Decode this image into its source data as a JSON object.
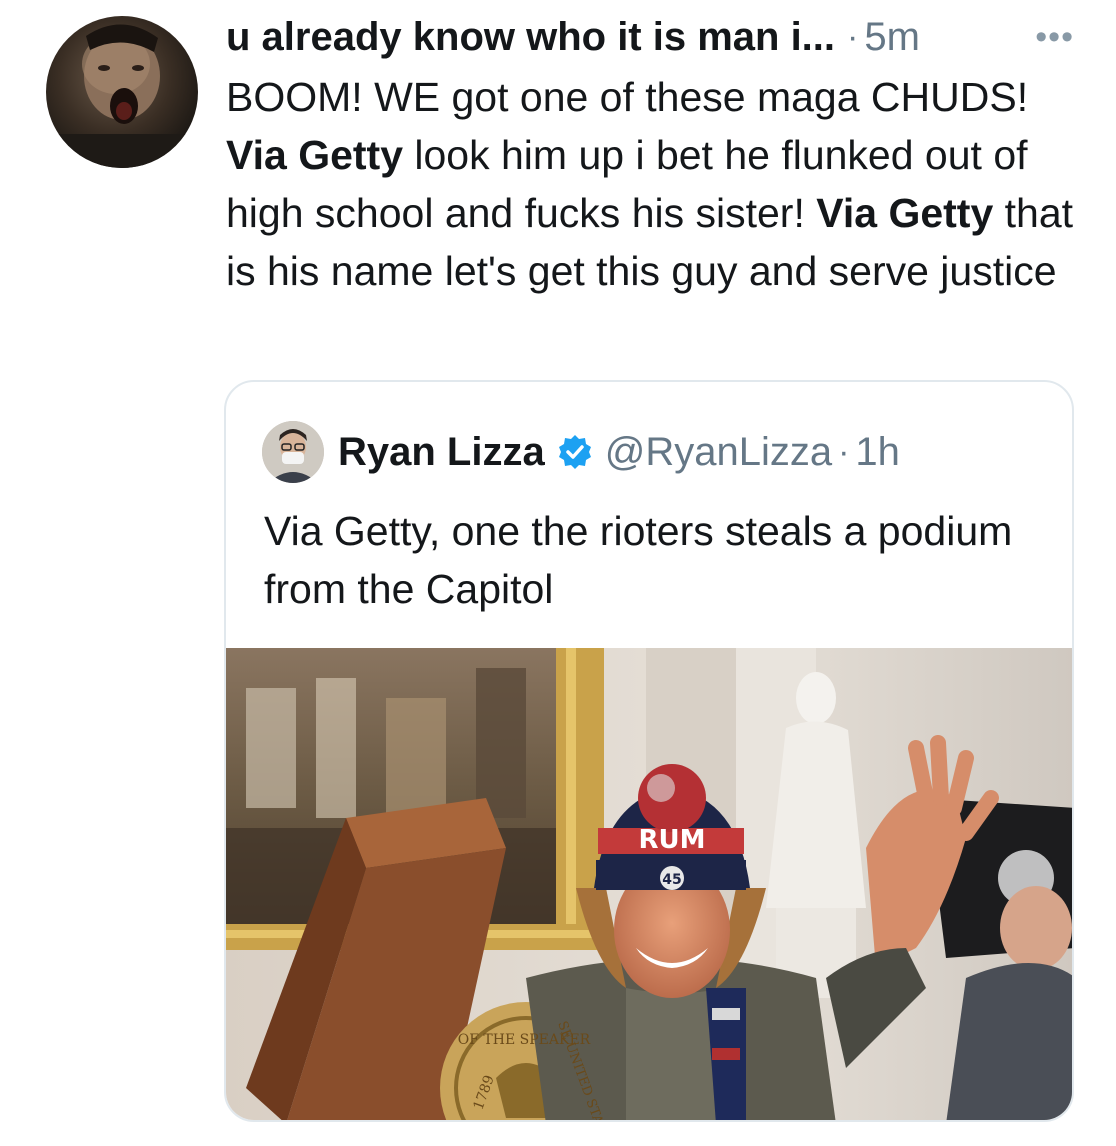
{
  "tweet": {
    "display_name": "u already know who it is man i...",
    "separator": "·",
    "time": "5m",
    "more_icon": "more-horizontal-icon",
    "text_segments": [
      {
        "text": "BOOM! WE got one of these maga CHUDS! ",
        "bold": false
      },
      {
        "text": "Via Getty",
        "bold": true
      },
      {
        "text": " look him up i bet he flunked out of high school and fucks his sister! ",
        "bold": false
      },
      {
        "text": "Via Getty",
        "bold": true
      },
      {
        "text": " that is his name let's get this guy and serve justice",
        "bold": false
      }
    ]
  },
  "quoted_tweet": {
    "name": "Ryan Lizza",
    "verified_icon": "verified-badge-icon",
    "handle": "@RyanLizza",
    "separator": "·",
    "time": "1h",
    "text": "Via Getty, one the rioters steals a podium from the Capitol",
    "image_text": {
      "hat": "RUM",
      "hat_badge": "45",
      "seal_top": "OF THE SPEAKER",
      "seal_year": "1789",
      "seal_right": "SE UNITED STAT"
    }
  },
  "colors": {
    "text": "#14171a",
    "secondary": "#657786",
    "border": "#e1e8ed",
    "verified": "#1da1f2"
  }
}
